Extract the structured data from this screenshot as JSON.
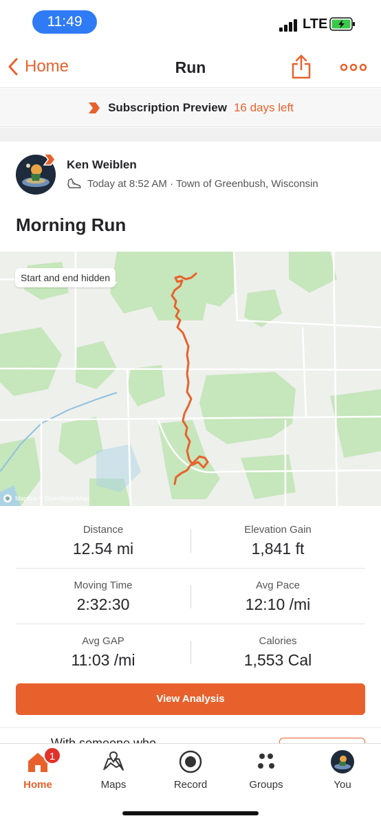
{
  "status_bar": {
    "time": "11:49",
    "network": "LTE"
  },
  "nav": {
    "back_label": "Home",
    "title": "Run"
  },
  "subscription": {
    "label": "Subscription Preview",
    "days_left": "16 days left"
  },
  "athlete": {
    "name": "Ken Weiblen",
    "meta": "Today at 8:52 AM · Town of Greenbush, Wisconsin"
  },
  "activity": {
    "title": "Morning Run"
  },
  "map": {
    "tag": "Start and end hidden",
    "attribution": "Mapbox © OpenStreetMap"
  },
  "stats": [
    {
      "left_label": "Distance",
      "left_value": "12.54 mi",
      "right_label": "Elevation Gain",
      "right_value": "1,841 ft"
    },
    {
      "left_label": "Moving Time",
      "left_value": "2:32:30",
      "right_label": "Avg Pace",
      "right_value": "12:10 /mi"
    },
    {
      "left_label": "Avg GAP",
      "left_value": "11:03 /mi",
      "right_label": "Calories",
      "right_value": "1,553 Cal"
    }
  ],
  "analysis_button": "View Analysis",
  "partial_section": {
    "text": "With someone who"
  },
  "tabs": [
    {
      "label": "Home",
      "icon": "home-icon",
      "badge": "1"
    },
    {
      "label": "Maps",
      "icon": "maps-icon"
    },
    {
      "label": "Record",
      "icon": "record-icon"
    },
    {
      "label": "Groups",
      "icon": "groups-icon"
    },
    {
      "label": "You",
      "icon": "avatar"
    }
  ],
  "colors": {
    "accent": "#e8612c",
    "map_green": "#bfe3b4",
    "route": "#e8612c",
    "badge": "#e0322a"
  }
}
